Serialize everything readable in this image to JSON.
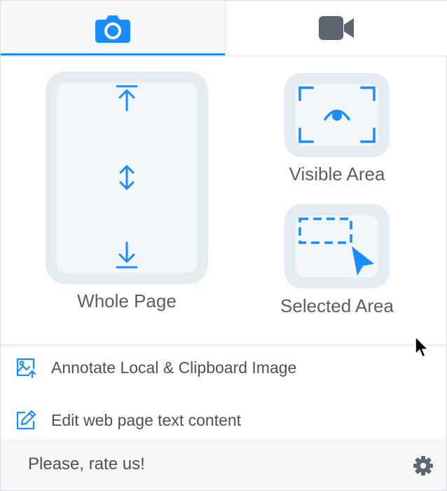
{
  "tabs": [
    {
      "icon": "camera-icon",
      "active": true
    },
    {
      "icon": "video-camera-icon",
      "active": false
    }
  ],
  "capture_options": {
    "whole_page": {
      "label": "Whole Page",
      "icon": "whole-page-icon"
    },
    "visible_area": {
      "label": "Visible Area",
      "icon": "visible-area-icon"
    },
    "selected_area": {
      "label": "Selected Area",
      "icon": "selected-area-icon"
    }
  },
  "menu": {
    "annotate": {
      "label": "Annotate Local & Clipboard Image",
      "icon": "image-upload-icon"
    },
    "edit": {
      "label": "Edit web page text content",
      "icon": "edit-icon"
    }
  },
  "footer": {
    "rate_label": "Please, rate us!",
    "settings_icon": "gear-icon"
  },
  "colors": {
    "accent": "#1a8cff",
    "icon_gray": "#5b6670",
    "tile_bg": "#e3ecf0",
    "text": "#4c5155"
  }
}
